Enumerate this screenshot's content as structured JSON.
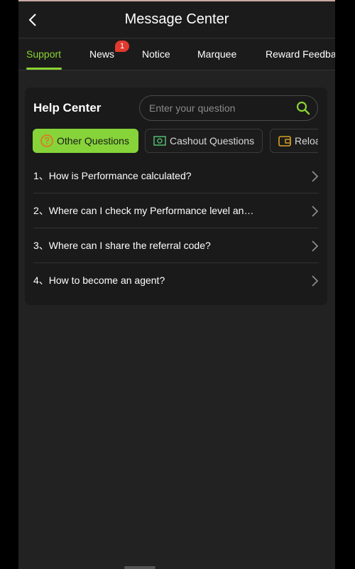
{
  "header": {
    "title": "Message Center"
  },
  "tabs": [
    {
      "label": "Support"
    },
    {
      "label": "News"
    },
    {
      "label": "Notice"
    },
    {
      "label": "Marquee"
    },
    {
      "label": "Reward Feedback"
    }
  ],
  "news_badge": "1",
  "help_center": {
    "title": "Help Center",
    "search_placeholder": "Enter your question"
  },
  "categories": [
    {
      "label": "Other Questions",
      "icon": "question-circle-icon"
    },
    {
      "label": "Cashout Questions",
      "icon": "cash-icon"
    },
    {
      "label": "Reload Questions",
      "icon": "wallet-icon"
    }
  ],
  "faqs": [
    {
      "text": "1、How is Performance calculated?"
    },
    {
      "text": "2、Where can I check my Performance level an…"
    },
    {
      "text": "3、Where can I share the referral code?"
    },
    {
      "text": "4、How to become an agent?"
    }
  ],
  "colors": {
    "accent": "#8bd332",
    "badge": "#e23a2e",
    "background": "#222222",
    "card": "#1a1a1a"
  }
}
